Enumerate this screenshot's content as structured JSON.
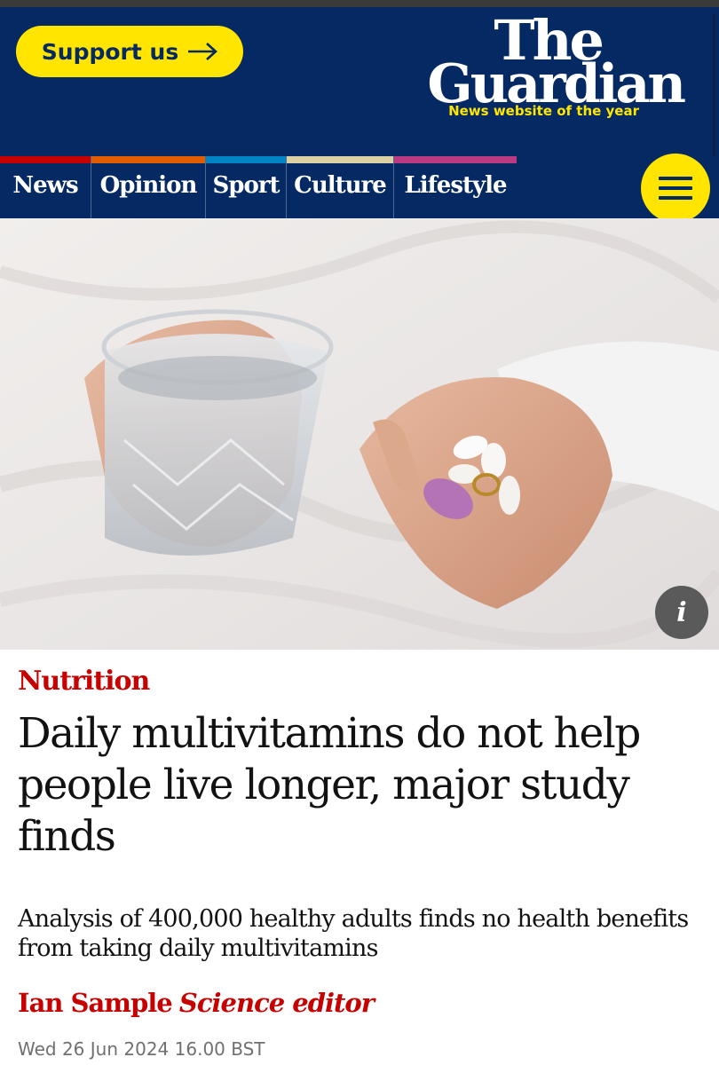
{
  "header": {
    "support_label": "Support us",
    "logo_line1": "The",
    "logo_line2": "Guardian",
    "tagline": "News website of the year"
  },
  "nav": {
    "items": [
      {
        "label": "News",
        "color": "#c70000"
      },
      {
        "label": "Opinion",
        "color": "#e05e00"
      },
      {
        "label": "Sport",
        "color": "#0084c6"
      },
      {
        "label": "Culture",
        "color": "#dcd0a4"
      },
      {
        "label": "Lifestyle",
        "color": "#bb3b80"
      }
    ],
    "menu_icon": "hamburger-icon"
  },
  "article": {
    "kicker": "Nutrition",
    "headline": "Daily multivitamins do not help people live longer, major study finds",
    "standfirst": "Analysis of 400,000 healthy adults finds no health benefits from taking daily multivitamins",
    "author": "Ian Sample",
    "author_role": "Science editor",
    "date": "Wed 26 Jun 2024 16.00 BST"
  },
  "image": {
    "info_label": "i"
  },
  "colors": {
    "brand_blue": "#052962",
    "brand_yellow": "#ffe500",
    "news_red": "#c70000"
  }
}
